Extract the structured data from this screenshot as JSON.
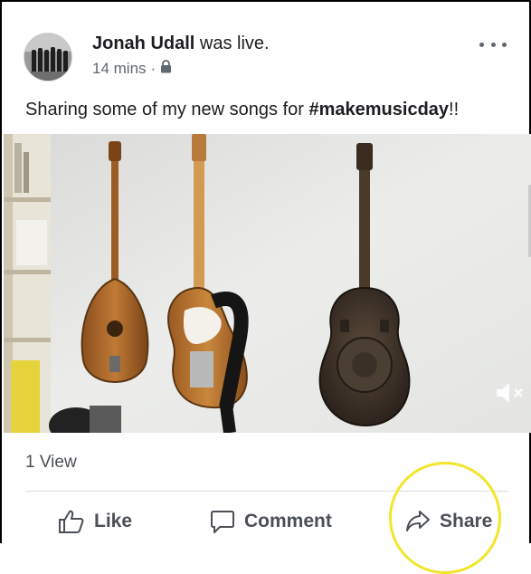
{
  "post": {
    "author": "Jonah Udall",
    "status_text": " was live.",
    "time": "14 mins",
    "separator": "·",
    "privacy_icon": "lock-icon",
    "more_icon": "more-dots-icon",
    "caption_prefix": "Sharing some of my new songs for ",
    "hashtag": "#makemusicday",
    "caption_suffix": "!!",
    "views": "1 View"
  },
  "actions": {
    "like_label": "Like",
    "comment_label": "Comment",
    "share_label": "Share"
  },
  "video": {
    "mute_icon": "speaker-muted-icon"
  },
  "colors": {
    "highlight": "#f2e52a",
    "text_secondary": "#606770"
  }
}
